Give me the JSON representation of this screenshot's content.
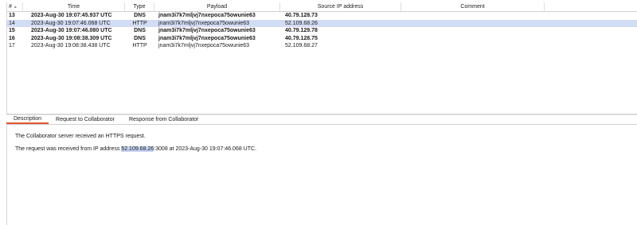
{
  "table": {
    "headers": {
      "num": "#",
      "time": "Time",
      "type": "Type",
      "payload": "Payload",
      "source_ip": "Source IP address",
      "comment": "Comment"
    },
    "rows": [
      {
        "num": "13",
        "time": "2023-Aug-30 19:07:45.937 UTC",
        "type": "DNS",
        "payload": "jnam3i7k7mljvj7nxepoca75owunie63",
        "source_ip": "40.79.128.73",
        "comment": ""
      },
      {
        "num": "14",
        "time": "2023-Aug-30 19:07:46.068 UTC",
        "type": "HTTP",
        "payload": "jnam3i7k7mljvj7nxepoca75owunie63",
        "source_ip": "52.109.68.26",
        "comment": ""
      },
      {
        "num": "15",
        "time": "2023-Aug-30 19:07:46.080 UTC",
        "type": "DNS",
        "payload": "jnam3i7k7mljvj7nxepoca75owunie63",
        "source_ip": "40.79.129.78",
        "comment": ""
      },
      {
        "num": "16",
        "time": "2023-Aug-30 19:08:38.309 UTC",
        "type": "DNS",
        "payload": "jnam3i7k7mljvj7nxepoca75owunie63",
        "source_ip": "40.79.128.75",
        "comment": ""
      },
      {
        "num": "17",
        "time": "2023-Aug-30 19:08:38.438 UTC",
        "type": "HTTP",
        "payload": "jnam3i7k7mljvj7nxepoca75owunie63",
        "source_ip": "52.109.68.27",
        "comment": ""
      }
    ]
  },
  "tabs": [
    "Description",
    "Request to Collaborator",
    "Response from Collaborator"
  ],
  "description": {
    "line1": "The Collaborator server received an HTTPS request.",
    "line2_prefix": "The request was received from IP address ",
    "line2_ip": "52.109.68.26",
    "line2_suffix": ":3008 at 2023-Aug-30 19:07:46.068 UTC."
  },
  "colors": {
    "selected_row": "#d2dcf4",
    "active_tab_underline": "#e2562c",
    "highlight": "#c7d4f2"
  }
}
